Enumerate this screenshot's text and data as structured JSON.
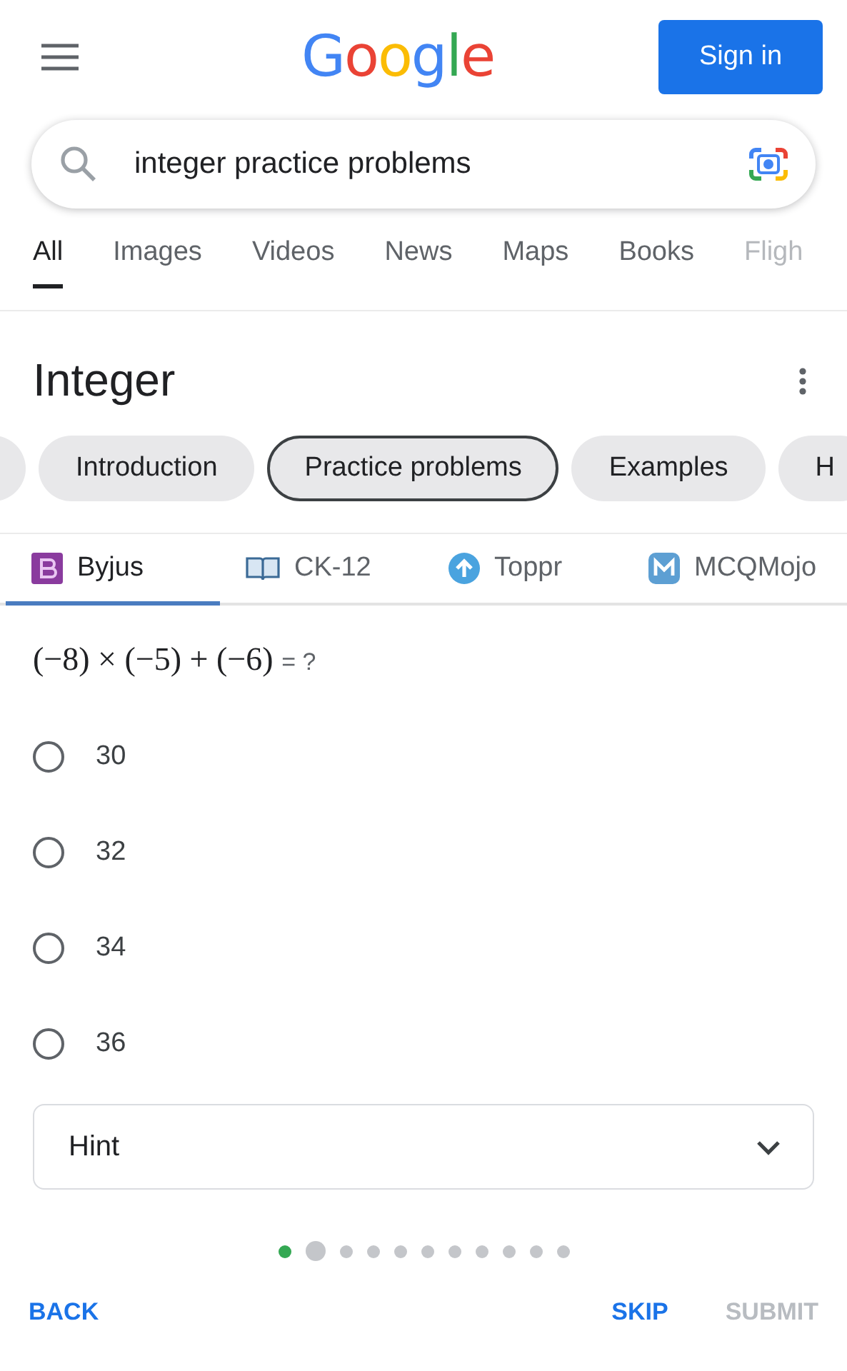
{
  "header": {
    "logo": "Google",
    "sign_in": "Sign in"
  },
  "search": {
    "value": "integer practice problems"
  },
  "tabs": [
    {
      "label": "All",
      "selected": true
    },
    {
      "label": "Images",
      "selected": false
    },
    {
      "label": "Videos",
      "selected": false
    },
    {
      "label": "News",
      "selected": false
    },
    {
      "label": "Maps",
      "selected": false
    },
    {
      "label": "Books",
      "selected": false
    },
    {
      "label": "Fligh",
      "selected": false
    }
  ],
  "title": "Integer",
  "chips": [
    {
      "label": "Introduction",
      "selected": false
    },
    {
      "label": "Practice problems",
      "selected": true
    },
    {
      "label": "Examples",
      "selected": false
    },
    {
      "label": "H",
      "selected": false
    }
  ],
  "sources": [
    {
      "label": "Byjus",
      "kind": "byjus",
      "selected": true
    },
    {
      "label": "CK-12",
      "kind": "book",
      "selected": false
    },
    {
      "label": "Toppr",
      "kind": "arrow",
      "selected": false
    },
    {
      "label": "MCQMojo",
      "kind": "mojo",
      "selected": false
    }
  ],
  "question": {
    "expression": "(−8) × (−5) + (−6)",
    "suffix": "= ?"
  },
  "options": [
    {
      "label": "30",
      "selected": false
    },
    {
      "label": "32",
      "selected": false
    },
    {
      "label": "34",
      "selected": false
    },
    {
      "label": "36",
      "selected": false
    }
  ],
  "hint": {
    "label": "Hint",
    "expanded": false
  },
  "progress": [
    {
      "kind": "done"
    },
    {
      "kind": "current"
    },
    {
      "kind": "todo"
    },
    {
      "kind": "todo"
    },
    {
      "kind": "todo"
    },
    {
      "kind": "todo"
    },
    {
      "kind": "todo"
    },
    {
      "kind": "todo"
    },
    {
      "kind": "todo"
    },
    {
      "kind": "todo"
    },
    {
      "kind": "todo"
    }
  ],
  "footer": [
    {
      "label": "BACK",
      "disabled": false
    },
    {
      "label": "SKIP",
      "disabled": false
    },
    {
      "label": "SUBMIT",
      "disabled": true
    }
  ]
}
